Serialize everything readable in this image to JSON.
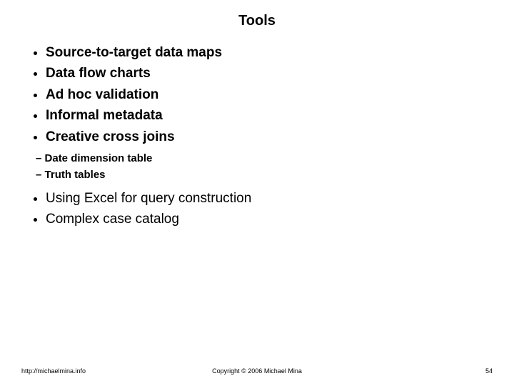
{
  "title": "Tools",
  "bullets_main": [
    "Source-to-target data maps",
    "Data flow charts",
    "Ad hoc validation",
    "Informal metadata",
    "Creative cross joins"
  ],
  "sub_bullets": [
    "Date dimension table",
    "Truth tables"
  ],
  "bullets_after": [
    "Using Excel for query construction",
    "Complex case catalog"
  ],
  "footer": {
    "left": "http://michaelmina.info",
    "center": "Copyright © 2006 Michael Mina",
    "right": "54"
  }
}
